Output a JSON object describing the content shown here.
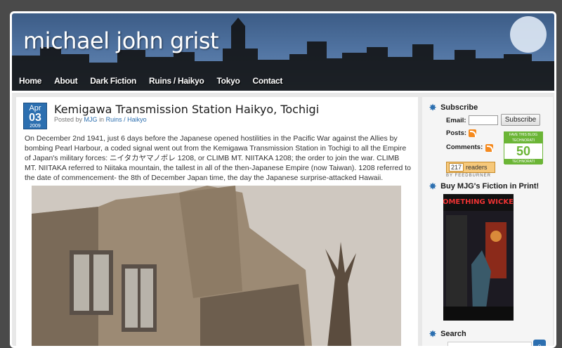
{
  "site": {
    "title": "michael john grist"
  },
  "nav": [
    "Home",
    "About",
    "Dark Fiction",
    "Ruins / Haikyo",
    "Tokyo",
    "Contact"
  ],
  "post": {
    "date_month": "Apr",
    "date_day": "03",
    "date_year": "2009",
    "title": "Kemigawa Transmission Station Haikyo, Tochigi",
    "posted_by": "Posted by",
    "author": "MJG",
    "in_word": "in",
    "category": "Ruins / Haikyo",
    "body": "On December 2nd 1941, just 6 days before the Japanese opened hostilities in the Pacific War against the Allies by bombing Pearl Harbour, a coded signal went out from the Kemigawa Transmission Station in Tochigi to all the Empire of Japan's military forces: ニイタカヤマノボレ 1208, or CLIMB MT. NIITAKA 1208; the order to join the war. CLIMB MT. NIITAKA referred to Niitaka mountain, the tallest in all of the then-Japanese Empire (now Taiwan). 1208 referred to the date of commencement- the 8th of December Japan time, the day the Japanese surprise-attacked Hawaii."
  },
  "sidebar": {
    "subscribe_title": "Subscribe",
    "email_label": "Email:",
    "subscribe_button": "Subscribe",
    "posts_label": "Posts:",
    "comments_label": "Comments:",
    "feed_count": "217",
    "feed_readers": "readers",
    "feed_caption": "BY FEEDBURNER",
    "technorati_top": "FAVE THIS BLOG TECHNORATI",
    "technorati_count": "50",
    "technorati_bottom": "TECHNORATI",
    "book_title": "Buy MJG's Fiction in Print!",
    "book_cover_title": "SOMETHING WICKED",
    "search_title": "Search"
  },
  "colors": {
    "accent": "#2c6fb0",
    "header": "#4f72a0"
  }
}
